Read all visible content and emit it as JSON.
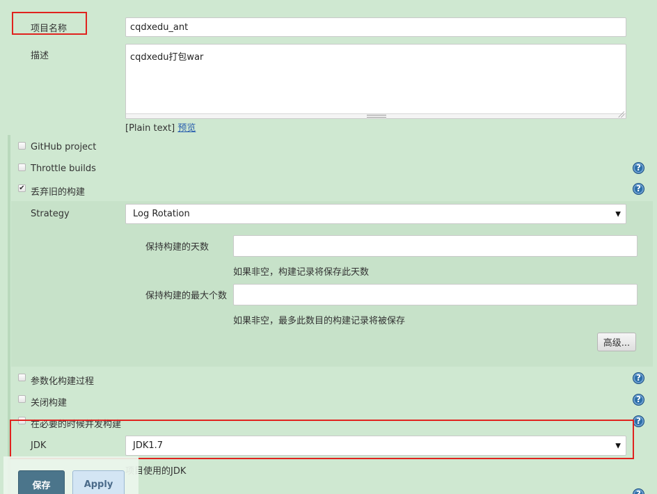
{
  "project_name": {
    "label": "项目名称",
    "value": "cqdxedu_ant"
  },
  "description": {
    "label": "描述",
    "value": "cqdxedu打包war",
    "format_label": "[Plain text]",
    "preview_link": "预览"
  },
  "options": {
    "github_project": {
      "label": "GitHub project",
      "checked": false
    },
    "throttle_builds": {
      "label": "Throttle builds",
      "checked": false
    },
    "discard_old_builds": {
      "label": "丢弃旧的构建",
      "checked": true,
      "check_glyph": "✔"
    }
  },
  "strategy": {
    "label": "Strategy",
    "selected": "Log Rotation",
    "days_to_keep": {
      "label": "保持构建的天数",
      "value": "",
      "hint": "如果非空，构建记录将保存此天数"
    },
    "max_builds": {
      "label": "保持构建的最大个数",
      "value": "",
      "hint": "如果非空，最多此数目的构建记录将被保存"
    },
    "advanced_button": "高级..."
  },
  "more_options": {
    "parameterized": {
      "label": "参数化构建过程",
      "checked": false
    },
    "disable_build": {
      "label": "关闭构建",
      "checked": false
    },
    "concurrent": {
      "label": "在必要的时候并发构建",
      "checked": false
    }
  },
  "jdk": {
    "label": "JDK",
    "selected": "JDK1.7",
    "hint": "项目使用的JDK"
  },
  "buttons": {
    "save": "保存",
    "apply": "Apply"
  },
  "icons": {
    "help": "?",
    "dropdown": "▼"
  },
  "colors": {
    "background": "#cfe8d1",
    "save_button": "#4b758b",
    "highlight": "#e0221e",
    "help_icon": "#2d6ea8"
  }
}
